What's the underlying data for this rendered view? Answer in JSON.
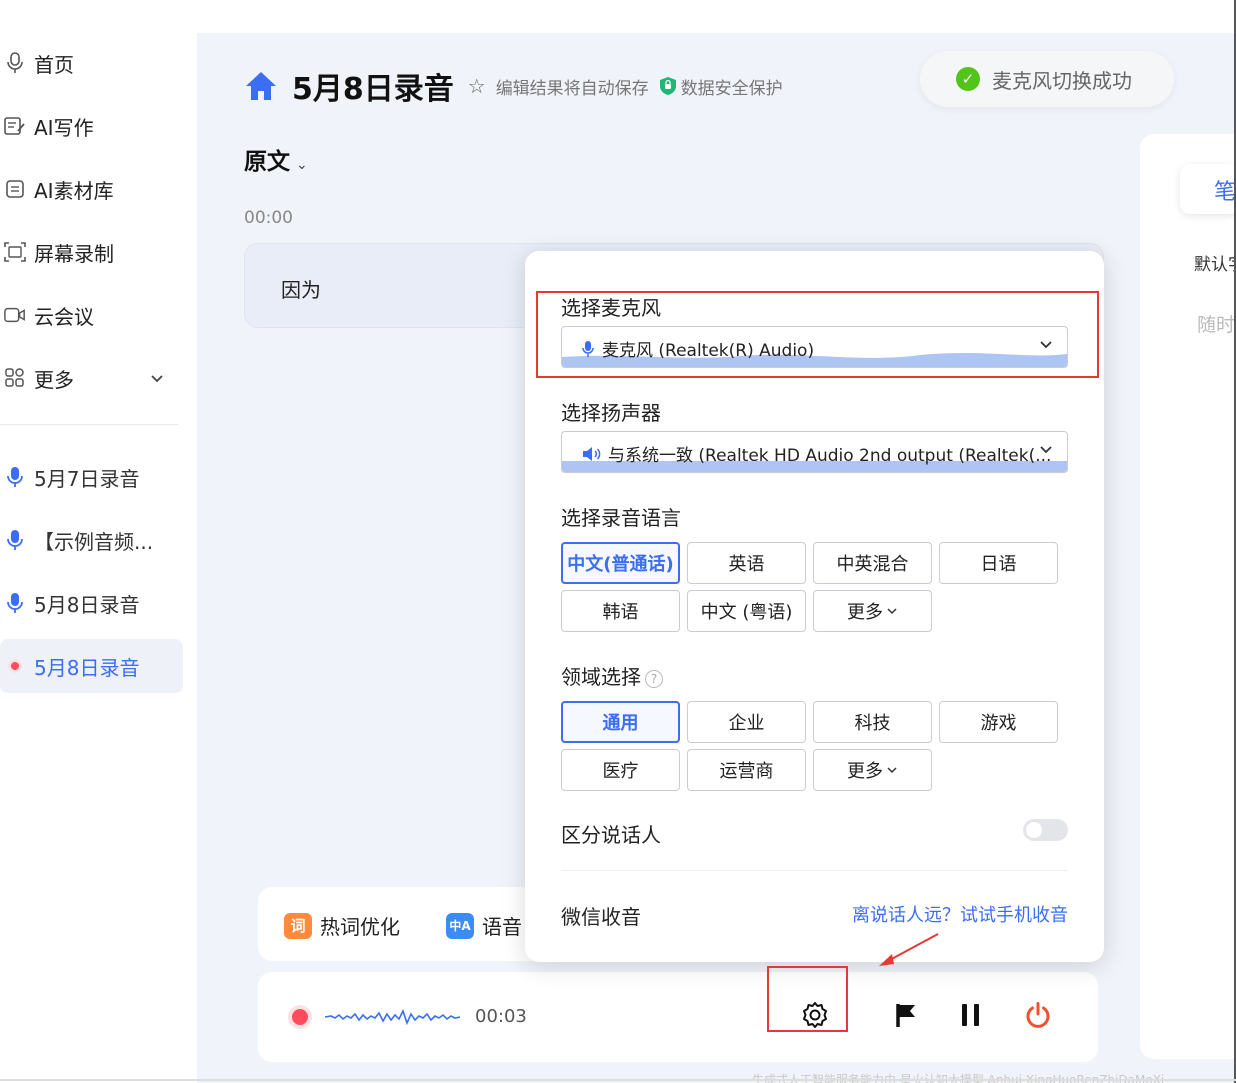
{
  "sidebar": {
    "nav": [
      {
        "label": "首页",
        "icon": "microphone-outline-icon"
      },
      {
        "label": "AI写作",
        "icon": "edit-note-icon"
      },
      {
        "label": "AI素材库",
        "icon": "library-icon"
      },
      {
        "label": "屏幕录制",
        "icon": "screen-record-icon"
      },
      {
        "label": "云会议",
        "icon": "video-camera-icon"
      },
      {
        "label": "更多",
        "icon": "grid-icon"
      }
    ],
    "recordings": [
      {
        "label": "5月7日录音"
      },
      {
        "label": "【示例音频..."
      },
      {
        "label": "5月8日录音"
      },
      {
        "label": "5月8日录音",
        "active": true
      }
    ]
  },
  "header": {
    "title": "5月8日录音",
    "autosave": "编辑结果将自动保存",
    "security": "数据安全保护"
  },
  "toast": {
    "text": "麦克风切换成功"
  },
  "transcript": {
    "tab": "原文",
    "time": "00:00",
    "text": "因为"
  },
  "right_panel": {
    "tab": "笔",
    "text1": "默认字",
    "text2": "随时"
  },
  "tools": {
    "hotword_badge": "词",
    "hotword": "热词优化",
    "lang_badge": "中A",
    "lang": "语音"
  },
  "control": {
    "timer": "00:03"
  },
  "popup": {
    "mic_label": "选择麦克风",
    "mic_value": "麦克风 (Realtek(R) Audio)",
    "speaker_label": "选择扬声器",
    "speaker_value": "与系统一致  (Realtek HD Audio 2nd output (Realtek(...",
    "lang_label": "选择录音语言",
    "langs": [
      "中文(普通话)",
      "英语",
      "中英混合",
      "日语",
      "韩语",
      "中文 (粤语)",
      "更多"
    ],
    "domain_label": "领域选择",
    "domains": [
      "通用",
      "企业",
      "科技",
      "游戏",
      "医疗",
      "运营商",
      "更多"
    ],
    "speaker_diarization": "区分说话人",
    "wechat": "微信收音",
    "phone_link": "离说话人远？试试手机收音"
  },
  "footer": {
    "note": "生成式人工智能服务能力由 星火认知大模型   Anhui-XingHuoRenZhiDaMoXi"
  },
  "colors": {
    "accent": "#3b6df5",
    "record": "#ff4d5e",
    "annotation": "#e53935",
    "success": "#52c41a"
  }
}
